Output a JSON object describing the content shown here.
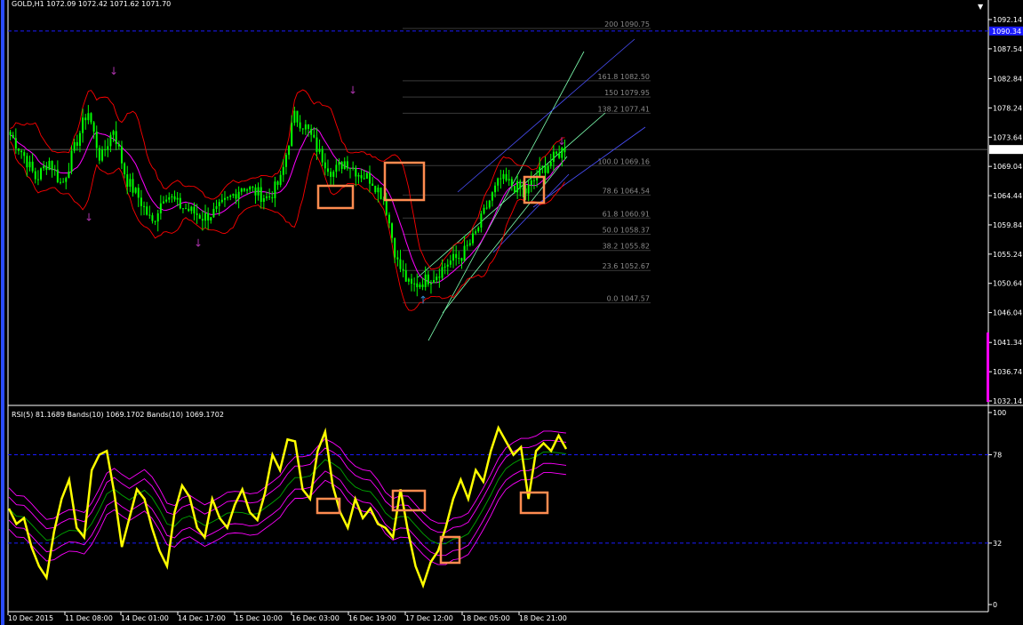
{
  "header": {
    "main_title": "GOLD,H1  1072.09 1072.42 1071.62 1071.70",
    "sub_title": "RSI(5) 81.1689  Bands(10) 1069.1702  Bands(10) 1069.1702"
  },
  "price_axis": {
    "ticks": [
      "1092.14",
      "1087.54",
      "1082.84",
      "1078.24",
      "1073.64",
      "1069.04",
      "1064.44",
      "1059.84",
      "1055.24",
      "1050.64",
      "1046.04",
      "1041.34",
      "1036.74",
      "1032.14"
    ],
    "current_price": "1071.70",
    "line_price": "1090.34"
  },
  "rsi_axis": {
    "ticks": [
      "100",
      "78",
      "32",
      "0"
    ]
  },
  "time_axis": {
    "labels": [
      "10 Dec 2015",
      "11 Dec 08:00",
      "14 Dec 01:00",
      "14 Dec 17:00",
      "15 Dec 10:00",
      "16 Dec 03:00",
      "16 Dec 19:00",
      "17 Dec 12:00",
      "18 Dec 05:00",
      "18 Dec 21:00"
    ]
  },
  "fibonacci": [
    {
      "label": "200  1090.75"
    },
    {
      "label": "161.8  1082.50"
    },
    {
      "label": "150  1079.95"
    },
    {
      "label": "138.2  1077.41"
    },
    {
      "label": "100.0  1069.16"
    },
    {
      "label": "78.6  1064.54"
    },
    {
      "label": "61.8  1060.91"
    },
    {
      "label": "50.0  1058.37"
    },
    {
      "label": "38.2  1055.82"
    },
    {
      "label": "23.6  1052.67"
    },
    {
      "label": "0.0  1047.57"
    }
  ],
  "colors": {
    "background": "#000000",
    "bull_candle": "#00ff00",
    "bollinger": "#ff0000",
    "moving_average": "#ff00ff",
    "rsi_line": "#ffff00",
    "rsi_bands": "#ff00ff",
    "rsi_mid": "#00aa00",
    "highlight_box": "#ff8c50",
    "channel": "#7dffb0",
    "trend": "#4a50ff",
    "dashed_level": "#1a1aff",
    "fib_level": "#3a3a3a"
  },
  "chart_data": [
    {
      "type": "candlestick",
      "title": "GOLD,H1",
      "xlabel": "",
      "ylabel": "",
      "x": [
        "10 Dec 2015",
        "11 Dec 08:00",
        "14 Dec 01:00",
        "14 Dec 17:00",
        "15 Dec 10:00",
        "16 Dec 03:00",
        "16 Dec 19:00",
        "17 Dec 12:00",
        "18 Dec 05:00",
        "18 Dec 21:00"
      ],
      "close_path": [
        1074,
        1071,
        1067,
        1070,
        1066,
        1072,
        1078,
        1070,
        1075,
        1067,
        1064,
        1060,
        1065,
        1063,
        1062,
        1061,
        1062,
        1064,
        1066,
        1065,
        1064,
        1067,
        1077,
        1075,
        1071,
        1068,
        1070,
        1068,
        1067,
        1064,
        1054,
        1050,
        1051,
        1052,
        1054,
        1055,
        1058,
        1063,
        1067,
        1066,
        1065,
        1068,
        1070,
        1072
      ],
      "ylim": [
        1032.14,
        1092.14
      ],
      "last_close": 1071.7,
      "dashed_level": 1090.34
    },
    {
      "type": "line",
      "title": "RSI(5) 81.1689",
      "ylim": [
        0,
        100
      ],
      "levels": [
        78,
        32
      ],
      "values": [
        50,
        42,
        45,
        30,
        20,
        14,
        38,
        55,
        65,
        40,
        35,
        70,
        78,
        80,
        58,
        30,
        45,
        60,
        55,
        40,
        28,
        20,
        48,
        62,
        56,
        40,
        35,
        55,
        45,
        40,
        52,
        60,
        48,
        44,
        58,
        78,
        70,
        86,
        85,
        60,
        55,
        80,
        90,
        62,
        48,
        40,
        55,
        45,
        50,
        42,
        40,
        35,
        60,
        38,
        20,
        10,
        22,
        28,
        40,
        55,
        65,
        55,
        70,
        64,
        80,
        92,
        85,
        78,
        82,
        55,
        80,
        84,
        80,
        88,
        81
      ]
    }
  ]
}
